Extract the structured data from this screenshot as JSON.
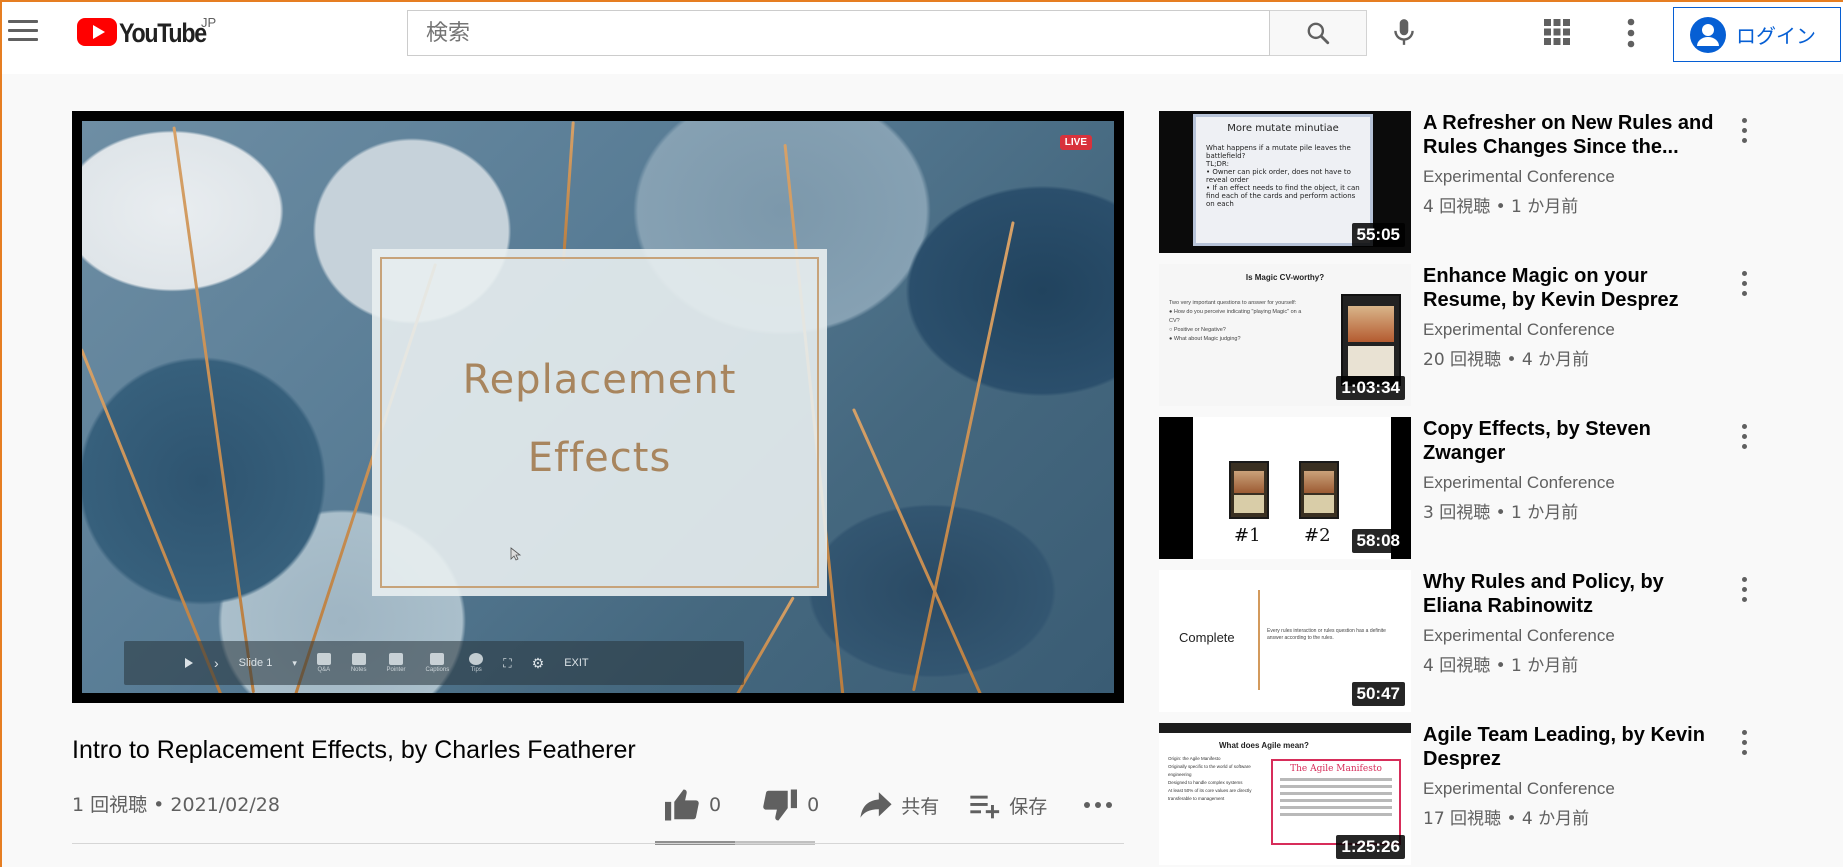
{
  "header": {
    "logo_text": "YouTube",
    "logo_region": "JP",
    "search_placeholder": "検索",
    "login_label": "ログイン",
    "icons": [
      "menu-icon",
      "search-icon",
      "mic-icon",
      "apps-icon",
      "more-vert-icon",
      "account-icon"
    ]
  },
  "player": {
    "live_badge": "LIVE",
    "slide_title_line1": "Replacement",
    "slide_title_line2": "Effects",
    "toolbar": {
      "slide_label": "Slide 1",
      "items": [
        "Q&A",
        "Notes",
        "Pointer",
        "Captions",
        "Tips"
      ],
      "exit_label": "EXIT"
    }
  },
  "video": {
    "title": "Intro to Replacement Effects, by Charles Featherer",
    "meta": "1 回視聴 • 2021/02/28",
    "likes": "0",
    "dislikes": "0",
    "share_label": "共有",
    "save_label": "保存",
    "like_ratio": 0.5
  },
  "related": [
    {
      "title": "A Refresher on New Rules and Rules Changes Since the...",
      "channel": "Experimental Conference",
      "stats": "4 回視聴 • 1 か月前",
      "duration": "55:05",
      "thumb_heading": "More mutate minutiae",
      "thumb_lines": [
        "What happens if a mutate pile leaves the battlefield?",
        "TL;DR:",
        "• Owner can pick order, does not have to reveal order",
        "• If an effect needs to find the object, it can find each of the cards and perform actions on each"
      ]
    },
    {
      "title": "Enhance Magic on your Resume, by Kevin Desprez",
      "channel": "Experimental Conference",
      "stats": "20 回視聴 • 4 か月前",
      "duration": "1:03:34",
      "thumb_heading": "Is Magic CV-worthy?",
      "thumb_lines": [
        "Two very important questions to answer for yourself:",
        "● How do you perceive indicating \"playing Magic\" on a CV?",
        "○ Positive or Negative?",
        "● What about Magic judging?"
      ]
    },
    {
      "title": "Copy Effects, by Steven Zwanger",
      "channel": "Experimental Conference",
      "stats": "3 回視聴 • 1 か月前",
      "duration": "58:08",
      "thumb_labels": [
        "#1",
        "#2"
      ]
    },
    {
      "title": "Why Rules and Policy, by Eliana Rabinowitz",
      "channel": "Experimental Conference",
      "stats": "4 回視聴 • 1 か月前",
      "duration": "50:47",
      "thumb_heading": "Complete",
      "thumb_desc": "Every rules interaction or rules question has a definite answer according to the rules."
    },
    {
      "title": "Agile Team Leading, by Kevin Desprez",
      "channel": "Experimental Conference",
      "stats": "17 回視聴 • 4 か月前",
      "duration": "1:25:26",
      "thumb_heading": "What does Agile mean?",
      "thumb_box_heading": "The Agile Manifesto",
      "thumb_lines": [
        "Origin: the Agile Manifesto",
        "Originally specific to the world of software engineering",
        "Designed to handle complex systems",
        "At least 50% of its core values are directly transferable to management"
      ]
    }
  ],
  "colors": {
    "brand_red": "#ff0000",
    "link_blue": "#065fd4",
    "frame_orange": "#e67e22"
  }
}
